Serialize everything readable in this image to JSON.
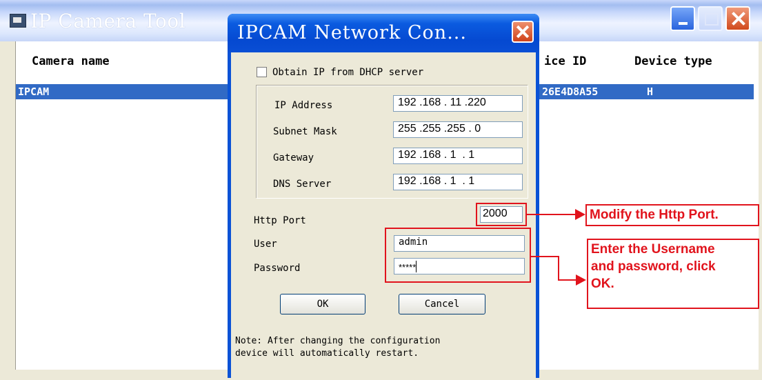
{
  "app": {
    "title": "IP Camera Tool",
    "columns": [
      "Camera name",
      "ice ID",
      "Device type"
    ],
    "row": {
      "name": "IPCAM",
      "device_id": "26E4D8A55",
      "device_type": "H"
    }
  },
  "dialog": {
    "title": "IPCAM Network Con...",
    "dhcp_label": "Obtain IP from DHCP server",
    "dhcp_checked": false,
    "ip_label": "IP Address",
    "ip_value": "192 .168 . 11 .220",
    "subnet_label": "Subnet Mask",
    "subnet_value": "255 .255 .255 . 0",
    "gateway_label": "Gateway",
    "gateway_value": "192 .168 . 1  . 1",
    "dns_label": "DNS Server",
    "dns_value": "192 .168 . 1  . 1",
    "port_label": "Http Port",
    "port_value": "2000",
    "user_label": "User",
    "user_value": "admin",
    "password_label": "Password",
    "password_value": "*****",
    "ok_label": "OK",
    "cancel_label": "Cancel",
    "note_line1": "Note: After changing the configuration",
    "note_line2": "device will automatically restart."
  },
  "annotations": {
    "callout_port": "Modify the Http Port.",
    "callout_user_line1": "Enter the Username",
    "callout_user_line2": "and password, click",
    "callout_user_line3": "OK."
  },
  "colors": {
    "highlight": "#e1131c",
    "xp_titlebar": "#0a52d6",
    "selection": "#316ac5",
    "dialog_face": "#ece9d8"
  },
  "icons": [
    "app-icon",
    "minimize-icon",
    "maximize-icon",
    "close-icon",
    "arrow-right-icon"
  ]
}
